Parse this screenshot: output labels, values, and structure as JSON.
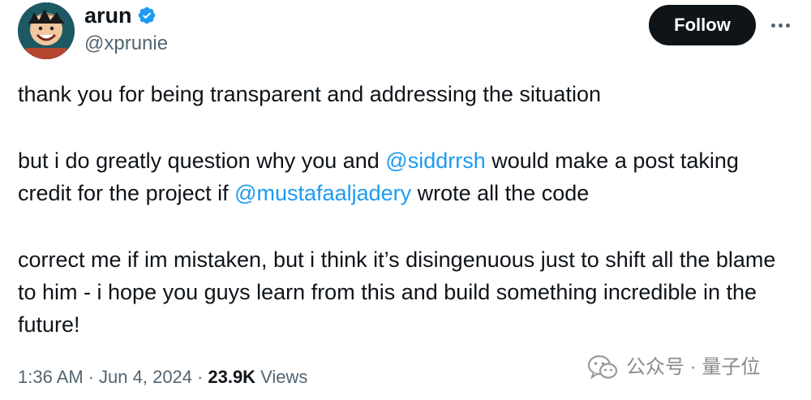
{
  "author": {
    "display_name": "arun",
    "handle": "@xprunie",
    "verified": true,
    "avatar_icon": "anime-avatar"
  },
  "actions": {
    "follow_label": "Follow",
    "more_icon": "more-horizontal-icon"
  },
  "tweet": {
    "paragraphs": [
      {
        "segments": [
          {
            "text": "thank you for being transparent and addressing the situation",
            "type": "text"
          }
        ]
      },
      {
        "segments": [
          {
            "text": "but i do greatly question why you and ",
            "type": "text"
          },
          {
            "text": "@siddrrsh",
            "type": "mention"
          },
          {
            "text": " would make a post taking credit for the project if ",
            "type": "text"
          },
          {
            "text": "@mustafaaljadery",
            "type": "mention"
          },
          {
            "text": " wrote all the code",
            "type": "text"
          }
        ]
      },
      {
        "segments": [
          {
            "text": "correct me if im mistaken, but i think it’s disingenuous just to shift all the blame to him - i hope you guys learn from this and build something incredible in the future!",
            "type": "text"
          }
        ]
      }
    ]
  },
  "meta": {
    "time": "1:36 AM",
    "separator": "·",
    "date": "Jun 4, 2024",
    "views_count": "23.9K",
    "views_label": "Views"
  },
  "watermark": {
    "text": "公众号 · 量子位",
    "icon": "wechat-logo-icon"
  },
  "colors": {
    "accent": "#1d9bf0",
    "text": "#0f1419",
    "secondary": "#536471",
    "follow_bg": "#0f1419"
  }
}
